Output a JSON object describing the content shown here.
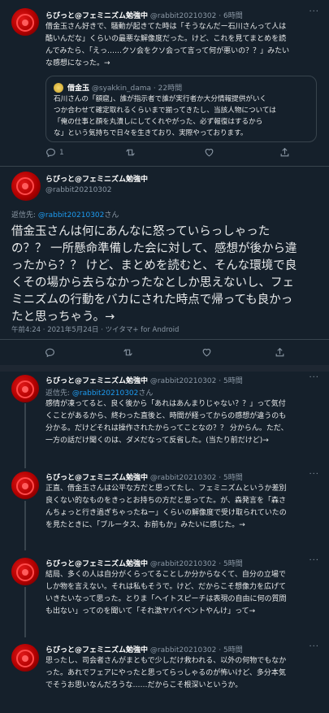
{
  "tweets": [
    {
      "name": "らびっと@フェミニズム勉強中",
      "handle": "@rabbit20210302",
      "time": "6時間",
      "lines": [
        "借金玉さん好きで、騒動が起きてた時は「そうなんだー石川さんって人は",
        "酷いんだな」くらいの最悪な解像度だった。けど、これを見てまとめを読",
        "んでみたら、「えっ……クソ会をクソ会って言って何が悪いの？？」みたい",
        "な感想になった。→"
      ],
      "replies": "1"
    },
    {
      "name": "らびっと@フェミニズム勉強中",
      "handle": "@rabbit20210302",
      "reply_prefix": "返信先: ",
      "reply_to": "@rabbit20210302",
      "reply_suffix": "さん",
      "lines": [
        "借金玉さんは何にあんなに怒っていらっしゃった",
        "の？？ 一所懸命準備した会に対して、感想が後から違",
        "ったから？？ けど、まとめを読むと、そんな環境で良",
        "くその場から去らなかったなとしか思えないし、フェ",
        "ミニズムの行動をバカにされた時点で帰っても良かっ",
        "たと思っちゃう。→"
      ],
      "meta": "午前4:24 · 2021年5月24日 · ツイタマ+ for Android"
    },
    {
      "name": "らびっと@フェミニズム勉強中",
      "handle": "@rabbit20210302",
      "time": "5時間",
      "reply_prefix": "返信先: ",
      "reply_to": "@rabbit20210302",
      "reply_suffix": "さん",
      "lines": [
        "感情が凍ってると、良く後から「あれはあんまりじゃない？？」って気付",
        "くことがあるから、終わった直後と、時間が経ってからの感想が違うのも",
        "分かる。だけどそれは操作されたからってことなの？？ 分からん。ただ、",
        "一方の話だけ聞くのは、ダメだなって反省した。(当たり前だけど)→"
      ]
    },
    {
      "name": "らびっと@フェミニズム勉強中",
      "handle": "@rabbit20210302",
      "time": "5時間",
      "lines": [
        "正直、借金玉さんは公平な方だと思ってたし、フェミニズムというか差別",
        "良くない的なものをきっとお持ちの方だと思ってた。が、森発言を「森さ",
        "んちょっと行き過ぎちゃったねー」くらいの解像度で受け取られていたの",
        "を見たときに、「ブルータス、お前もか」みたいに感じた。→"
      ]
    },
    {
      "name": "らびっと@フェミニズム勉強中",
      "handle": "@rabbit20210302",
      "time": "5時間",
      "lines": [
        "結局、多くの人は自分がくらってることしか分からなくて、自分の立場で",
        "しか物を言えない。それは私もそうで。けど、だからこそ想像力を広げて",
        "いきたいなって思った。とりま「ヘイトスピーチは表現の自由に何の質問",
        "も出ない」ってのを聞いて「それ激ヤバイベントやんけ」って→"
      ]
    },
    {
      "name": "らびっと@フェミニズム勉強中",
      "handle": "@rabbit20210302",
      "time": "5時間",
      "lines": [
        "思ったし、司会者さんがまともで少しだけ救われる、以外の何物でもなか",
        "った。あれでフェアにやったと思ってらっしゃるのが怖いけど、多分本気",
        "でそうお思いなんだろうな……だからこそ根深いというか。"
      ]
    }
  ],
  "quote": {
    "name": "借金玉",
    "handle": "@syakkin_dama",
    "time": "22時間",
    "lines": [
      "石川さんの「額窟」、誰が指示者で誰が実行者か大分情報提供がいく",
      "つか合わせて確定取れるくらいまで揃ってきたし、当該人物については",
      "「俺の仕事と顔を丸潰しにしてくれやがった、必ず報復はするから",
      "な」という気持ちで日々を生きており、実際やっております。"
    ]
  },
  "sep": " · ",
  "more": "···",
  "icons": [
    "reply-icon",
    "retweet-icon",
    "like-icon",
    "share-icon"
  ]
}
